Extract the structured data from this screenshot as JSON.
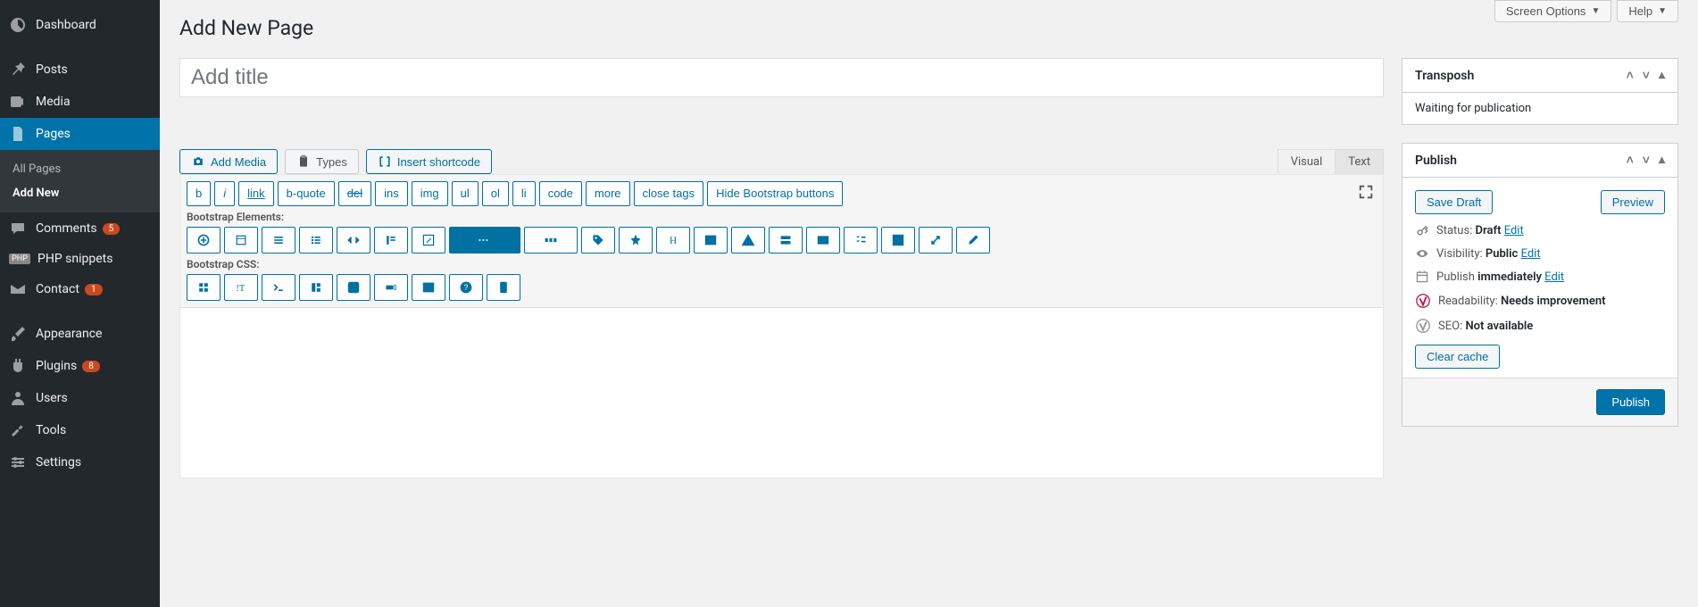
{
  "top": {
    "screen_options": "Screen Options",
    "help": "Help"
  },
  "sidebar": {
    "dashboard": "Dashboard",
    "posts": "Posts",
    "media": "Media",
    "pages": "Pages",
    "all_pages": "All Pages",
    "add_new_sub": "Add New",
    "comments": "Comments",
    "comments_count": "5",
    "php_snippets": "PHP snippets",
    "contact": "Contact",
    "contact_count": "1",
    "appearance": "Appearance",
    "plugins": "Plugins",
    "plugins_count": "8",
    "users": "Users",
    "tools": "Tools",
    "settings": "Settings"
  },
  "page": {
    "title": "Add New Page",
    "title_placeholder": "Add title"
  },
  "media_buttons": {
    "add_media": "Add Media",
    "types": "Types",
    "insert_shortcode": "Insert shortcode"
  },
  "tabs": {
    "visual": "Visual",
    "text": "Text"
  },
  "qt": {
    "b": "b",
    "i": "i",
    "link": "link",
    "bquote": "b-quote",
    "del": "del",
    "ins": "ins",
    "img": "img",
    "ul": "ul",
    "ol": "ol",
    "li": "li",
    "code": "code",
    "more": "more",
    "close": "close tags",
    "hide_bs": "Hide Bootstrap buttons",
    "bs_elements_label": "Bootstrap Elements:",
    "bs_css_label": "Bootstrap CSS:"
  },
  "transposh": {
    "title": "Transposh",
    "status": "Waiting for publication"
  },
  "publish": {
    "title": "Publish",
    "save_draft": "Save Draft",
    "preview": "Preview",
    "status_label": "Status: ",
    "status_value": "Draft",
    "visibility_label": "Visibility: ",
    "visibility_value": "Public",
    "publish_label": "Publish ",
    "publish_value": "immediately",
    "edit": "Edit",
    "readability_label": "Readability: ",
    "readability_value": "Needs improvement",
    "seo_label": "SEO: ",
    "seo_value": "Not available",
    "clear_cache": "Clear cache",
    "publish_btn": "Publish"
  }
}
